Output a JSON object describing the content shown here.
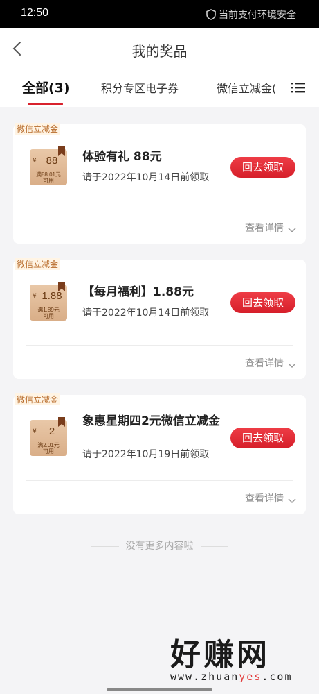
{
  "status_bar": {
    "time": "12:50",
    "security_text": "当前支付环境安全"
  },
  "header": {
    "title": "我的奖品"
  },
  "tabs": [
    {
      "label": "全部(3)",
      "active": true
    },
    {
      "label": "积分专区电子券",
      "active": false
    },
    {
      "label": "微信立减金(",
      "active": false
    }
  ],
  "prizes": [
    {
      "tag": "微信立减金",
      "coupon_yen": "¥",
      "coupon_amount": "88",
      "coupon_condition_1": "满88.01元",
      "coupon_condition_2": "可用",
      "name": "体验有礼 88元",
      "deadline": "请于2022年10月14日前领取",
      "action": "回去领取",
      "details": "查看详情"
    },
    {
      "tag": "微信立减金",
      "coupon_yen": "¥",
      "coupon_amount": "1.88",
      "coupon_condition_1": "满1.89元",
      "coupon_condition_2": "可用",
      "name": "【每月福利】1.88元",
      "deadline": "请于2022年10月14日前领取",
      "action": "回去领取",
      "details": "查看详情"
    },
    {
      "tag": "微信立减金",
      "coupon_yen": "¥",
      "coupon_amount": "2",
      "coupon_condition_1": "满2.01元",
      "coupon_condition_2": "可用",
      "name": "象惠星期四2元微信立减金",
      "deadline": "请于2022年10月19日前领取",
      "action": "回去领取",
      "details": "查看详情"
    }
  ],
  "footer": {
    "no_more": "没有更多内容啦"
  },
  "watermark": {
    "big": "好赚网",
    "small_a": "www.zhuan",
    "small_b": "yes",
    "small_c": ".com"
  },
  "colors": {
    "accent": "#d61f2a",
    "tag_text": "#b86b2a",
    "coupon_bg": "#dcb18c"
  }
}
